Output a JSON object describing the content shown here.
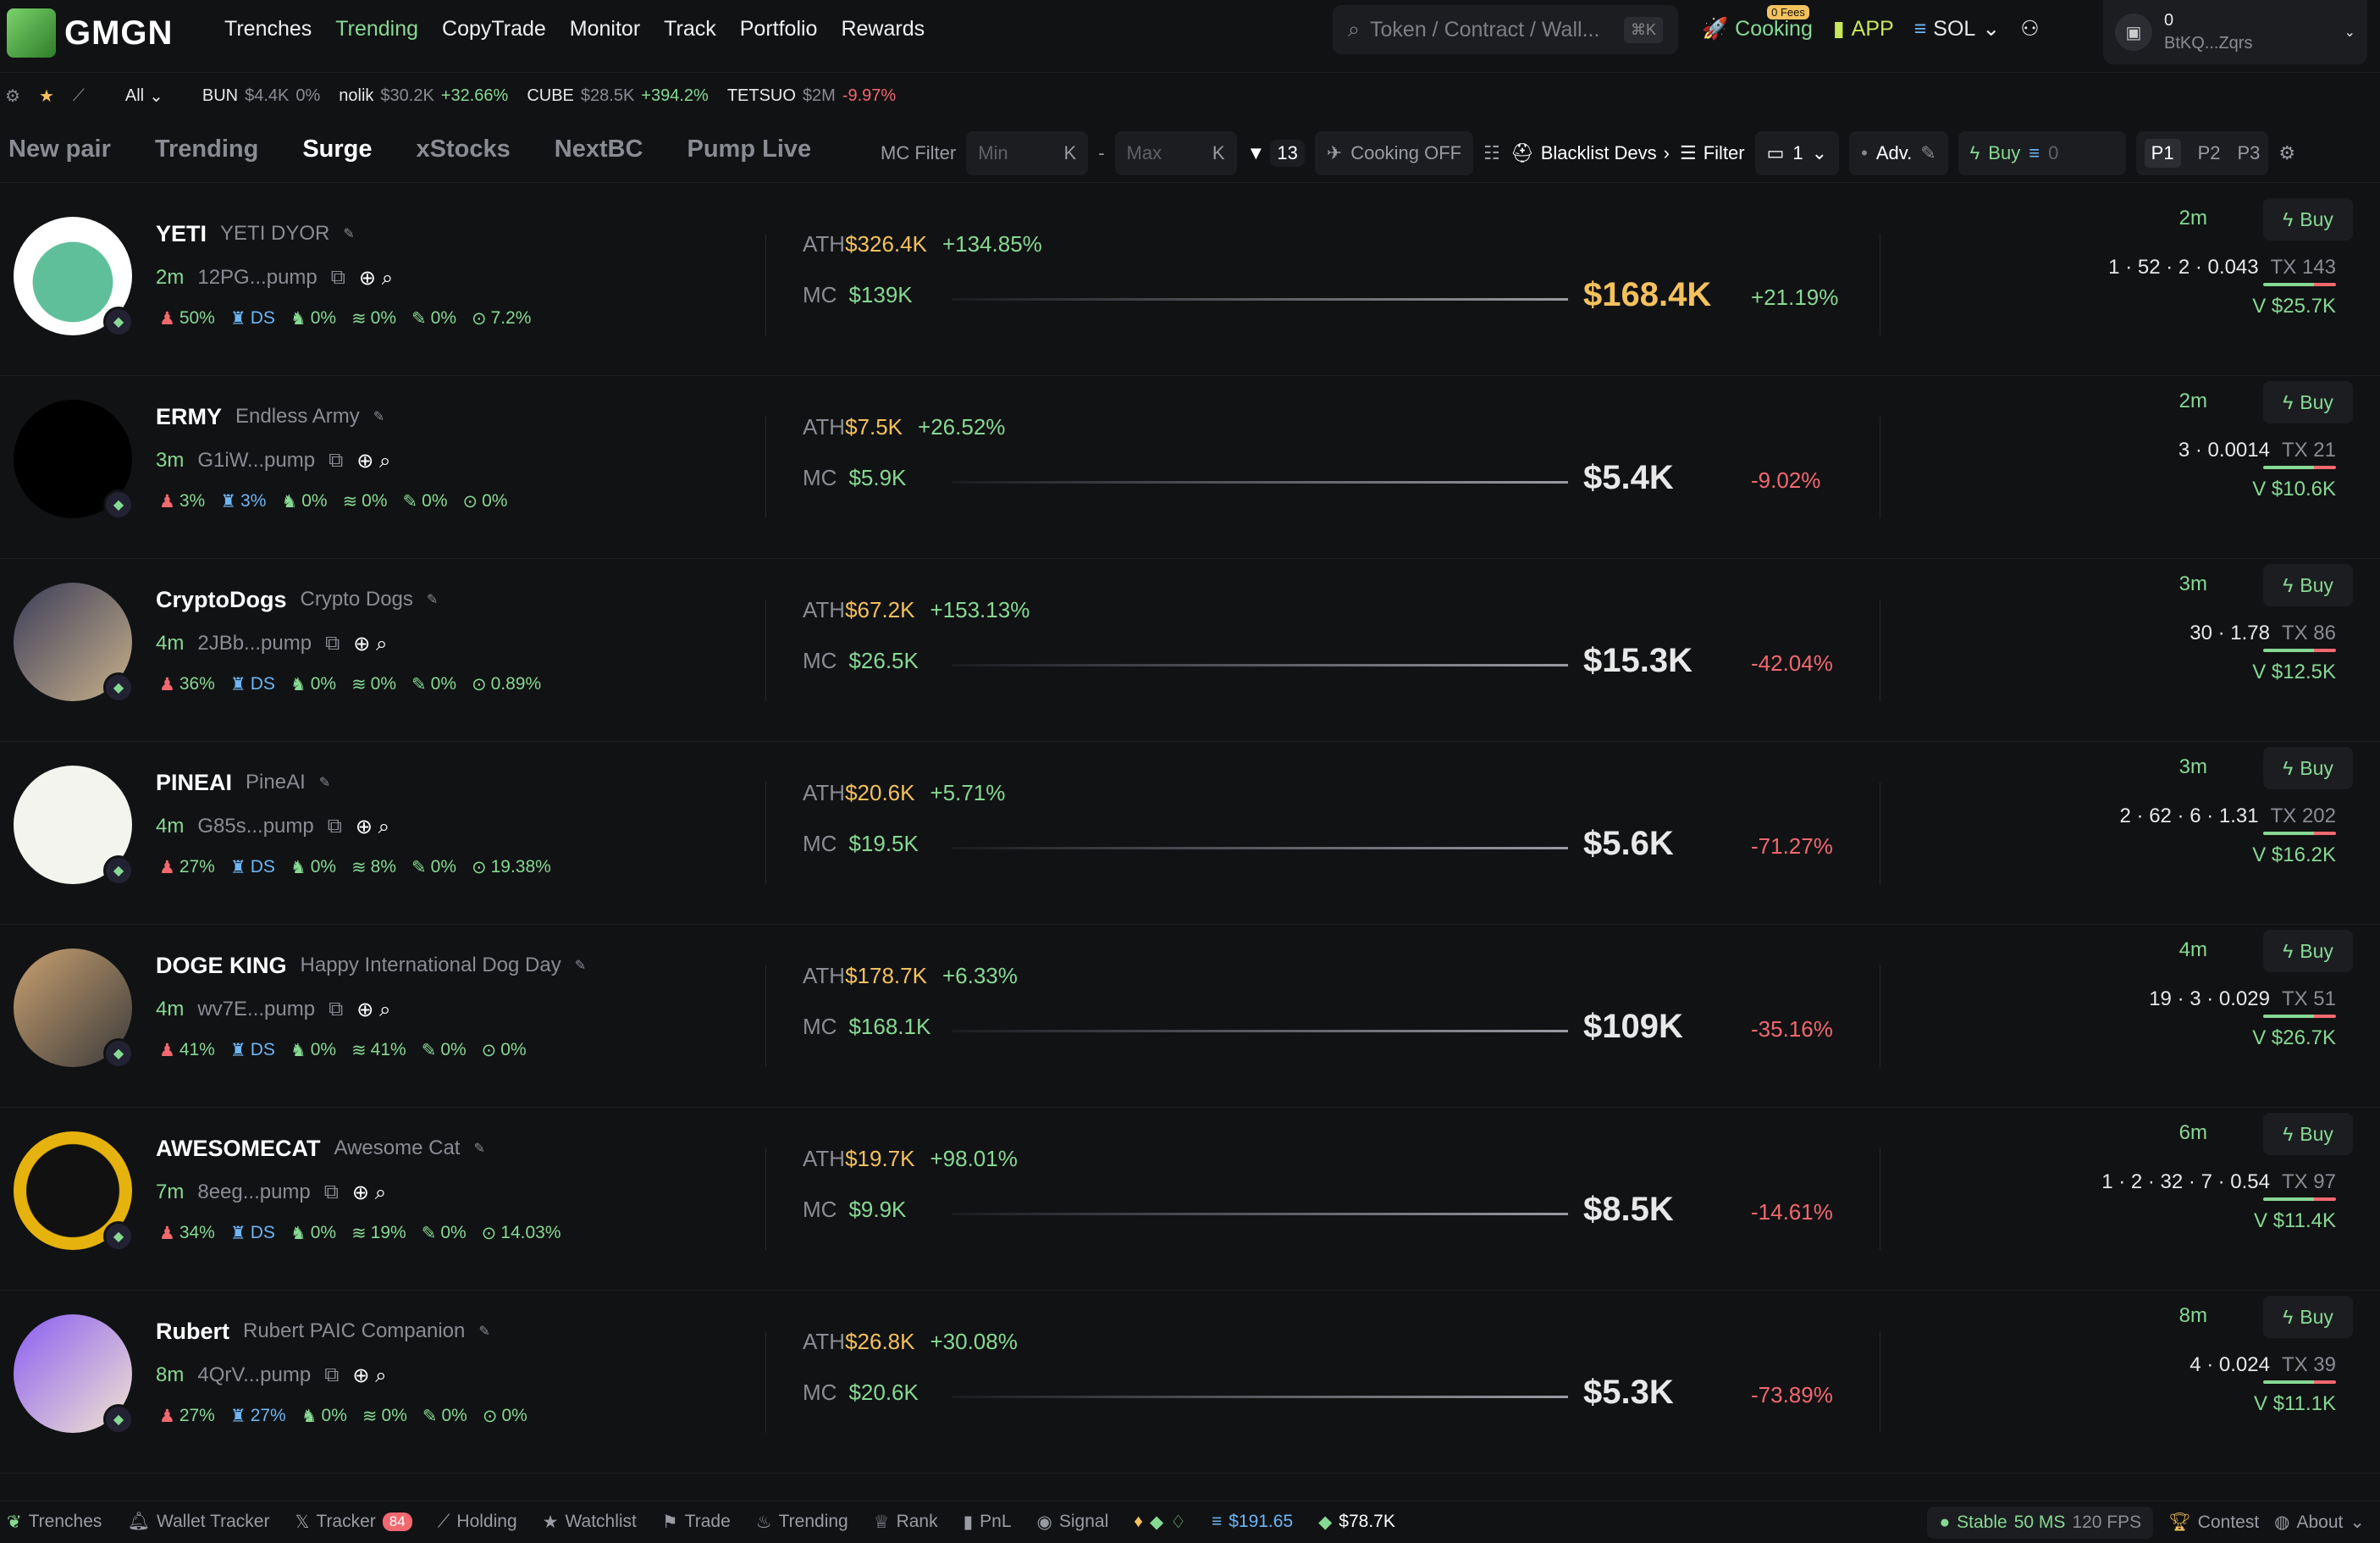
{
  "app": {
    "logo": "GMGN"
  },
  "nav": [
    "Trenches",
    "Trending",
    "CopyTrade",
    "Monitor",
    "Track",
    "Portfolio",
    "Rewards"
  ],
  "search": {
    "placeholder": "Token / Contract / Wall...",
    "shortcut": "⌘K"
  },
  "top": {
    "cooking": "Cooking",
    "fees_badge": "0 Fees",
    "app": "APP",
    "chain": "SOL",
    "wallet_balance": "0",
    "wallet_addr": "BtKQ...Zqrs"
  },
  "ticker": {
    "filter": "All",
    "items": [
      {
        "sym": "BUN",
        "mc": "$4.4K",
        "chg": "0%"
      },
      {
        "sym": "nolik",
        "mc": "$30.2K",
        "chg": "+32.66%"
      },
      {
        "sym": "CUBE",
        "mc": "$28.5K",
        "chg": "+394.2%"
      },
      {
        "sym": "TETSUO",
        "mc": "$2M",
        "chg": "-9.97%"
      }
    ]
  },
  "tabs": [
    "New pair",
    "Trending",
    "Surge",
    "xStocks",
    "NextBC",
    "Pump Live"
  ],
  "filters": {
    "mc": "MC Filter",
    "min": "Min",
    "max": "Max",
    "k": "K",
    "dash": "-",
    "count": "13",
    "cooking": "Cooking OFF",
    "blacklist": "Blacklist Devs",
    "filter": "Filter",
    "page": "1",
    "adv": "Adv.",
    "buy": "Buy",
    "buy_amt": "0",
    "p1": "P1",
    "p2": "P2",
    "p3": "P3"
  },
  "rows": [
    {
      "sym": "YETI",
      "name": "YETI DYOR",
      "age": "2m",
      "addr": "12PG...pump",
      "h": "50%",
      "dev": "DS",
      "t": "0%",
      "s": "0%",
      "p": "0%",
      "x": "7.2%",
      "ath": "$326.4K",
      "athchg": "+134.85%",
      "mc": "$139K",
      "price": "$168.4K",
      "chg": "+21.19%",
      "time": "2m",
      "buy": "Buy",
      "st": "1 · 52 · 2 · 0.043",
      "tx": "TX 143",
      "vol": "V $25.7K"
    },
    {
      "sym": "ERMY",
      "name": "Endless Army",
      "age": "3m",
      "addr": "G1iW...pump",
      "h": "3%",
      "dev": "3%",
      "t": "0%",
      "s": "0%",
      "p": "0%",
      "x": "0%",
      "ath": "$7.5K",
      "athchg": "+26.52%",
      "mc": "$5.9K",
      "price": "$5.4K",
      "chg": "-9.02%",
      "time": "2m",
      "buy": "Buy",
      "st": "3 · 0.0014",
      "tx": "TX 21",
      "vol": "V $10.6K"
    },
    {
      "sym": "CryptoDogs",
      "name": "Crypto Dogs",
      "age": "4m",
      "addr": "2JBb...pump",
      "h": "36%",
      "dev": "DS",
      "t": "0%",
      "s": "0%",
      "p": "0%",
      "x": "0.89%",
      "ath": "$67.2K",
      "athchg": "+153.13%",
      "mc": "$26.5K",
      "price": "$15.3K",
      "chg": "-42.04%",
      "time": "3m",
      "buy": "Buy",
      "st": "30 · 1.78",
      "tx": "TX 86",
      "vol": "V $12.5K"
    },
    {
      "sym": "PINEAI",
      "name": "PineAI",
      "age": "4m",
      "addr": "G85s...pump",
      "h": "27%",
      "dev": "DS",
      "t": "0%",
      "s": "8%",
      "p": "0%",
      "x": "19.38%",
      "ath": "$20.6K",
      "athchg": "+5.71%",
      "mc": "$19.5K",
      "price": "$5.6K",
      "chg": "-71.27%",
      "time": "3m",
      "buy": "Buy",
      "st": "2 · 62 · 6 · 1.31",
      "tx": "TX 202",
      "vol": "V $16.2K"
    },
    {
      "sym": "DOGE KING",
      "name": "Happy International Dog Day",
      "age": "4m",
      "addr": "wv7E...pump",
      "h": "41%",
      "dev": "DS",
      "t": "0%",
      "s": "41%",
      "p": "0%",
      "x": "0%",
      "ath": "$178.7K",
      "athchg": "+6.33%",
      "mc": "$168.1K",
      "price": "$109K",
      "chg": "-35.16%",
      "time": "4m",
      "buy": "Buy",
      "st": "19 · 3 · 0.029",
      "tx": "TX 51",
      "vol": "V $26.7K"
    },
    {
      "sym": "AWESOMECAT",
      "name": "Awesome Cat",
      "age": "7m",
      "addr": "8eeg...pump",
      "h": "34%",
      "dev": "DS",
      "t": "0%",
      "s": "19%",
      "p": "0%",
      "x": "14.03%",
      "ath": "$19.7K",
      "athchg": "+98.01%",
      "mc": "$9.9K",
      "price": "$8.5K",
      "chg": "-14.61%",
      "time": "6m",
      "buy": "Buy",
      "st": "1 · 2 · 32 · 7 · 0.54",
      "tx": "TX 97",
      "vol": "V $11.4K"
    },
    {
      "sym": "Rubert",
      "name": "Rubert PAIC Companion",
      "age": "8m",
      "addr": "4QrV...pump",
      "h": "27%",
      "dev": "27%",
      "t": "0%",
      "s": "0%",
      "p": "0%",
      "x": "0%",
      "ath": "$26.8K",
      "athchg": "+30.08%",
      "mc": "$20.6K",
      "price": "$5.3K",
      "chg": "-73.89%",
      "time": "8m",
      "buy": "Buy",
      "st": "4 · 0.024",
      "tx": "TX 39",
      "vol": "V $11.1K"
    }
  ],
  "footer": {
    "items": [
      "Trenches",
      "Wallet Tracker",
      "Tracker",
      "Holding",
      "Watchlist",
      "Trade",
      "Trending",
      "Rank",
      "PnL",
      "Signal"
    ],
    "tracker_count": "84",
    "sol": "$191.65",
    "pump": "$78.7K",
    "stable": "Stable",
    "ms": "50 MS",
    "fps": "120 FPS",
    "contest": "Contest",
    "about": "About"
  }
}
